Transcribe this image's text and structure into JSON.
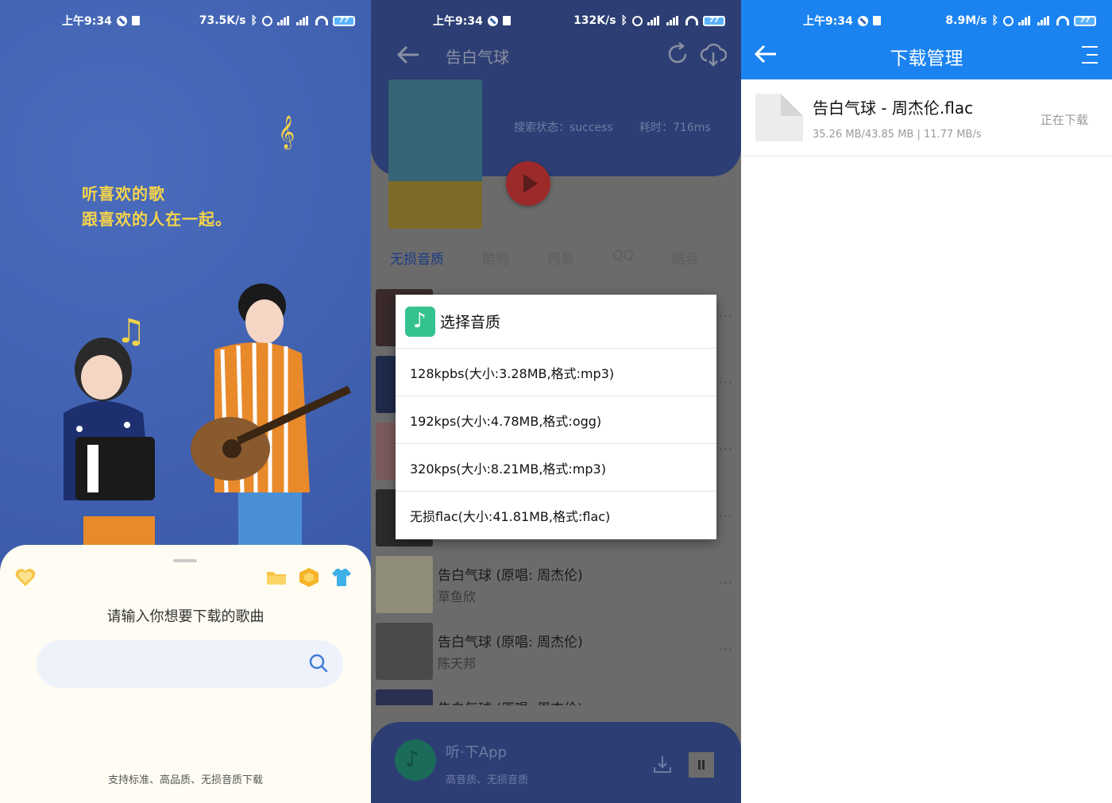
{
  "status_bars": [
    {
      "time": "上午9:34",
      "speed": "73.5K/s",
      "battery": "77"
    },
    {
      "time": "上午9:34",
      "speed": "132K/s",
      "battery": "77"
    },
    {
      "time": "上午9:34",
      "speed": "8.9M/s",
      "battery": "77"
    }
  ],
  "home": {
    "tagline_line1": "听喜欢的歌",
    "tagline_line2": "跟喜欢的人在一起。",
    "prompt": "请输入你想要下载的歌曲",
    "search": {
      "value": "",
      "placeholder": ""
    },
    "support_text": "支持标准、高品质、无损音质下载",
    "icons": [
      "heart-icon",
      "folder-icon",
      "hexagon-icon",
      "tshirt-icon",
      "search-icon"
    ]
  },
  "song": {
    "title": "告白气球",
    "search_status": "搜索状态：success",
    "time_cost": "耗时：716ms",
    "tabs": [
      "无损音质",
      "酷狗",
      "网易",
      "QQ",
      "酷我"
    ],
    "results": [
      {
        "title": "告白气球 (原唱: 周杰伦)",
        "artist": "草鱼欣"
      },
      {
        "title": "告白气球 (原唱: 周杰伦)",
        "artist": "陈天邦"
      },
      {
        "title": "告白气球 (原唱: 周杰伦)",
        "artist": ""
      }
    ],
    "more_label": "···"
  },
  "quality_dialog": {
    "title": "选择音质",
    "options": [
      "128kpbs(大小:3.28MB,格式:mp3)",
      "192kps(大小:4.78MB,格式:ogg)",
      "320kps(大小:8.21MB,格式:mp3)",
      "无损flac(大小:41.81MB,格式:flac)"
    ]
  },
  "mini_player": {
    "title": "听·下App",
    "subtitle": "高音质、无损音质"
  },
  "download_manager": {
    "title": "下载管理",
    "items": [
      {
        "name": "告白气球 - 周杰伦.flac",
        "meta": "35.26 MB/43.85 MB | 11.77 MB/s",
        "status": "正在下载"
      }
    ]
  },
  "colors": {
    "home_bg": "#3f62b1",
    "accent_yellow": "#f5d44a",
    "dark_blue": "#2c3e73",
    "manager_blue": "#1b83f0"
  }
}
